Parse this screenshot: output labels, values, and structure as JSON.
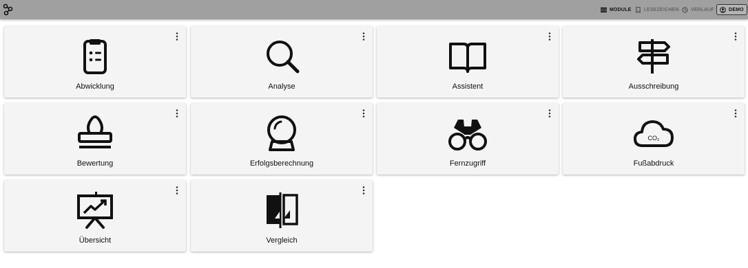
{
  "header": {
    "logo_icon": "app-logo-icon",
    "nav": [
      {
        "label": "MODULE",
        "icon": "list-icon"
      },
      {
        "label": "LESEZEICHEN",
        "icon": "bookmark-icon"
      },
      {
        "label": "VERLAUF",
        "icon": "history-icon"
      },
      {
        "label": "DEMO",
        "icon": "account-icon"
      }
    ]
  },
  "tiles": [
    {
      "label": "Abwicklung",
      "icon": "clipboard-icon"
    },
    {
      "label": "Analyse",
      "icon": "magnifier-icon"
    },
    {
      "label": "Assistent",
      "icon": "book-icon"
    },
    {
      "label": "Ausschreibung",
      "icon": "signpost-icon"
    },
    {
      "label": "Bewertung",
      "icon": "stamp-icon"
    },
    {
      "label": "Erfolgsberechnung",
      "icon": "crystal-ball-icon"
    },
    {
      "label": "Fernzugriff",
      "icon": "binoculars-icon"
    },
    {
      "label": "Fußabdruck",
      "icon": "co2-cloud-icon"
    },
    {
      "label": "Übersicht",
      "icon": "presentation-chart-icon"
    },
    {
      "label": "Vergleich",
      "icon": "compare-icon"
    }
  ],
  "co2_text": "CO₂"
}
